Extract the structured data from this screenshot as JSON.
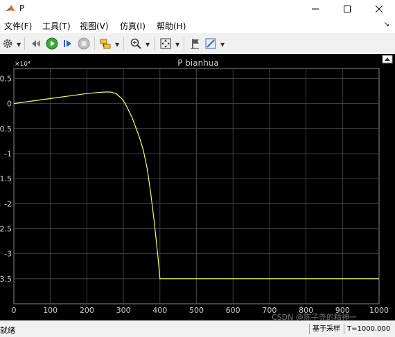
{
  "window": {
    "title": "P"
  },
  "menu": {
    "items": [
      "文件(F)",
      "工具(T)",
      "视图(V)",
      "仿真(I)",
      "帮助(H)"
    ]
  },
  "toolbar": {
    "buttons": [
      "gear-icon",
      "step-back-icon",
      "run-icon",
      "step-forward-icon",
      "stop-icon",
      "highlight-block-icon",
      "zoom-icon",
      "fit-to-view-icon",
      "cursor-measurements-icon",
      "style-icon"
    ]
  },
  "colors": {
    "plot_background": "#000000",
    "grid": "#505050",
    "trace": "#ffff66",
    "tick_text": "#d0d0d0"
  },
  "chart_data": {
    "type": "line",
    "title": "P bianhua",
    "exponent_label": "×10⁴",
    "xlabel": "",
    "ylabel": "",
    "xlim": [
      0,
      1000
    ],
    "ylim": [
      -4,
      0.7
    ],
    "xticks": [
      0,
      100,
      200,
      300,
      400,
      500,
      600,
      700,
      800,
      900,
      1000
    ],
    "yticks": [
      0.5,
      0,
      -0.5,
      -1,
      -1.5,
      -2,
      -2.5,
      -3,
      -3.5
    ],
    "ytick_labels": [
      "0.5",
      "0",
      "-0.5",
      "-1",
      "-1.5",
      "-2",
      "-2.5",
      "-3",
      "-3.5"
    ],
    "grid": true,
    "series": [
      {
        "x": [
          0,
          50,
          100,
          150,
          200,
          230,
          250,
          265,
          280,
          295,
          305,
          315,
          325,
          335,
          345,
          355,
          365,
          375,
          385,
          395,
          400,
          1000
        ],
        "values": [
          0.0,
          0.05,
          0.1,
          0.15,
          0.2,
          0.22,
          0.23,
          0.23,
          0.2,
          0.1,
          0.0,
          -0.15,
          -0.3,
          -0.5,
          -0.7,
          -0.95,
          -1.3,
          -1.8,
          -2.4,
          -3.1,
          -3.5,
          -3.5
        ]
      }
    ]
  },
  "statusbar": {
    "state": "就绪",
    "sample_mode": "基于采样",
    "time": "T=1000.000",
    "watermark": "CSDN @陈子尧的精神一"
  }
}
